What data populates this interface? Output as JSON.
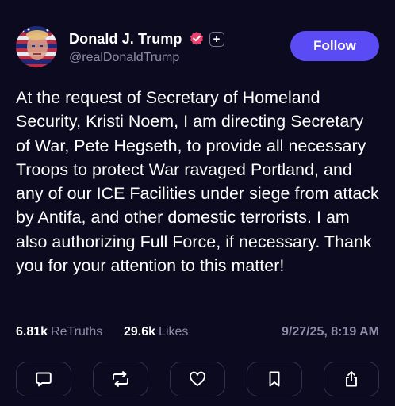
{
  "author": {
    "display_name": "Donald J. Trump",
    "handle": "@realDonaldTrump",
    "avatar_icon": "flag-portrait-avatar",
    "verified_icon": "verified-badge-icon",
    "verified_color": "#e8436f",
    "plus_badge": "+"
  },
  "follow_label": "Follow",
  "post": {
    "text": "At the request of Secretary of Homeland Security, Kristi Noem, I am directing Secretary of War, Pete Hegseth, to provide all necessary Troops to protect War ravaged Portland, and any of our ICE Facilities under siege from attack by Antifa, and other domestic terrorists. I am also authorizing Full Force, if necessary. Thank you for your attention to this matter!"
  },
  "stats": {
    "retruths_count": "6.81k",
    "retruths_label": "ReTruths",
    "likes_count": "29.6k",
    "likes_label": "Likes",
    "timestamp": "9/27/25, 8:19 AM"
  },
  "actions": [
    {
      "icon": "reply-icon"
    },
    {
      "icon": "retruth-icon"
    },
    {
      "icon": "like-icon"
    },
    {
      "icon": "bookmark-icon"
    },
    {
      "icon": "share-icon"
    }
  ],
  "colors": {
    "background": "#0c0a1e",
    "accent": "#5b4bf5",
    "muted_text": "#8e8ca8",
    "button_border": "#33304d"
  }
}
